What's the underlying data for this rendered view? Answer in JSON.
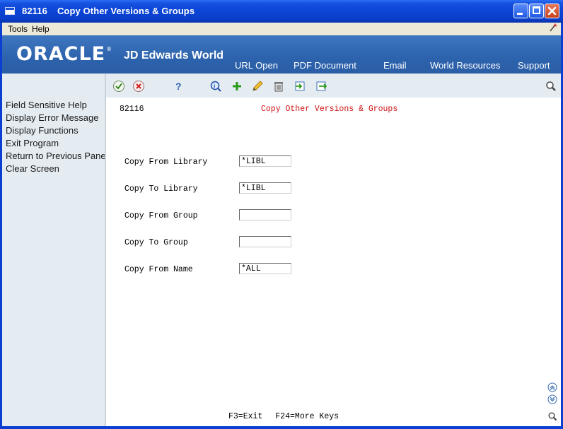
{
  "window": {
    "program_id": "82116",
    "title": "Copy Other Versions & Groups",
    "minimize_icon": "minimize-icon",
    "maximize_icon": "maximize-icon",
    "close_icon": "close-icon"
  },
  "menubar": {
    "items": [
      {
        "label": "Tools"
      },
      {
        "label": "Help"
      }
    ],
    "wizard_icon": "wand-icon"
  },
  "banner": {
    "logo": "ORACLE",
    "product": "JD Edwards World",
    "links": [
      {
        "label": "URL Open"
      },
      {
        "label": "PDF Document"
      },
      {
        "label": "Email"
      },
      {
        "label": "World Resources"
      },
      {
        "label": "Support"
      }
    ],
    "color": "#3e76bf"
  },
  "sidebar": {
    "items": [
      {
        "label": "Field Sensitive Help"
      },
      {
        "label": "Display Error Message"
      },
      {
        "label": "Display Functions"
      },
      {
        "label": "Exit Program"
      },
      {
        "label": "Return to Previous Panel"
      },
      {
        "label": "Clear Screen"
      }
    ]
  },
  "toolbar": {
    "icons": [
      "ok-check-icon",
      "cancel-x-icon",
      "help-question-icon",
      "inquire-icon",
      "add-plus-icon",
      "edit-pencil-icon",
      "delete-trash-icon",
      "copy-in-icon",
      "copy-out-icon",
      "search-icon"
    ]
  },
  "form": {
    "program_id": "82116",
    "title": "Copy Other Versions & Groups",
    "title_color": "#cc1111",
    "fields": [
      {
        "label": "Copy From Library",
        "value": "*LIBL"
      },
      {
        "label": "Copy To Library",
        "value": "*LIBL"
      },
      {
        "label": "Copy From Group",
        "value": ""
      },
      {
        "label": "Copy To Group",
        "value": ""
      },
      {
        "label": "Copy From Name",
        "value": "*ALL"
      }
    ]
  },
  "footer": {
    "keys": [
      "F3=Exit",
      "F24=More Keys"
    ]
  },
  "scroll_icons": [
    "scroll-up-icon",
    "scroll-down-icon",
    "zoom-icon"
  ]
}
